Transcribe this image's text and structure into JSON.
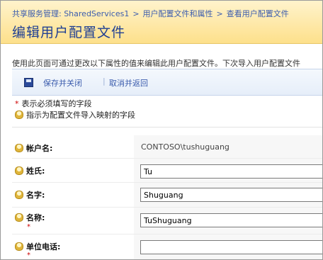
{
  "header": {
    "breadcrumb": [
      "共享服务管理: SharedServices1",
      "用户配置文件和属性",
      "查看用户配置文件"
    ],
    "breadcrumb_sep": ">",
    "title": "编辑用户配置文件"
  },
  "intro": "使用此页面可通过更改以下属性的值来编辑此用户配置文件。下次导入用户配置文件",
  "toolbar": {
    "save_close": "保存并关闭",
    "cancel_back": "取消并返回",
    "divider": "|"
  },
  "legend": {
    "required": "表示必须填写的字段",
    "mapped": "指示为配置文件导入映射的字段",
    "star": "*"
  },
  "fields": [
    {
      "label": "帐户名:",
      "value": "CONTOSO\\tushuguang",
      "editable": false,
      "required": false
    },
    {
      "label": "姓氏:",
      "value": "Tu",
      "editable": true,
      "required": false
    },
    {
      "label": "名字:",
      "value": "Shuguang",
      "editable": true,
      "required": false
    },
    {
      "label": "名称:",
      "value": "TuShuguang",
      "editable": true,
      "required": true
    },
    {
      "label": "单位电话:",
      "value": "",
      "editable": true,
      "required": true
    }
  ],
  "colors": {
    "link": "#3b5cad",
    "title": "#1f3f93",
    "header_bg": "#fde08b",
    "required": "#cc0000"
  }
}
